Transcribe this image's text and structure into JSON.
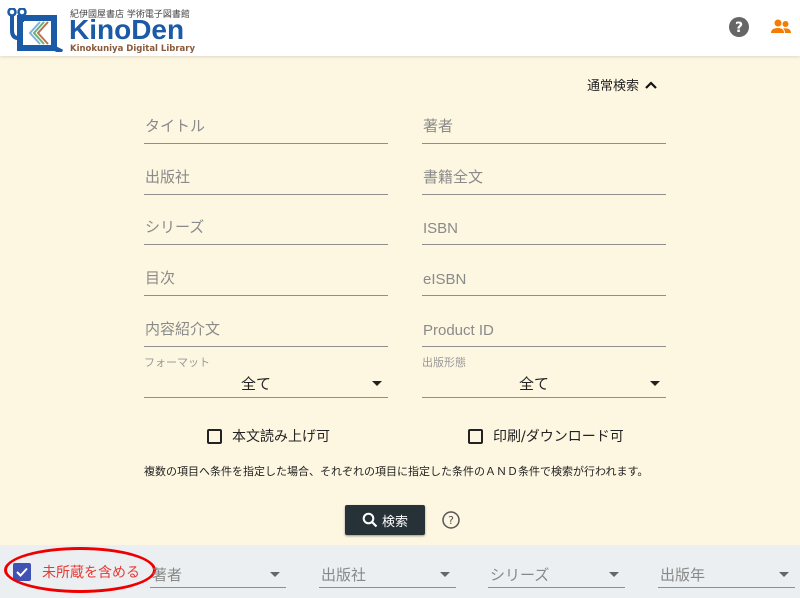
{
  "header": {
    "logo": {
      "small_text": "紀伊國屋書店 学術電子図書館",
      "brand": "KinoDen",
      "subtitle": "Kinokuniya Digital Library"
    },
    "icons": [
      "help-icon",
      "users-icon"
    ],
    "accent_color": "#f57c00"
  },
  "search": {
    "toggle_label": "通常検索",
    "fields_left": [
      {
        "placeholder": "タイトル"
      },
      {
        "placeholder": "出版社"
      },
      {
        "placeholder": "シリーズ"
      },
      {
        "placeholder": "目次"
      },
      {
        "placeholder": "内容紹介文"
      }
    ],
    "fields_right": [
      {
        "placeholder": "著者"
      },
      {
        "placeholder": "書籍全文"
      },
      {
        "placeholder": "ISBN"
      },
      {
        "placeholder": "eISBN"
      },
      {
        "placeholder": "Product ID"
      }
    ],
    "format": {
      "label": "フォーマット",
      "value": "全て"
    },
    "publication_type": {
      "label": "出版形態",
      "value": "全て"
    },
    "checkbox_tts": {
      "label": "本文読み上げ可",
      "checked": false
    },
    "checkbox_print": {
      "label": "印刷/ダウンロード可",
      "checked": false
    },
    "note": "複数の項目へ条件を指定した場合、それぞれの項目に指定した条件のＡＮＤ条件で検索が行われます。",
    "search_button": "検索"
  },
  "filter_bar": {
    "include_unowned": {
      "label": "未所蔵を含める",
      "checked": true
    },
    "selects": [
      {
        "placeholder": "著者"
      },
      {
        "placeholder": "出版社"
      },
      {
        "placeholder": "シリーズ"
      },
      {
        "placeholder": "出版年"
      }
    ]
  }
}
